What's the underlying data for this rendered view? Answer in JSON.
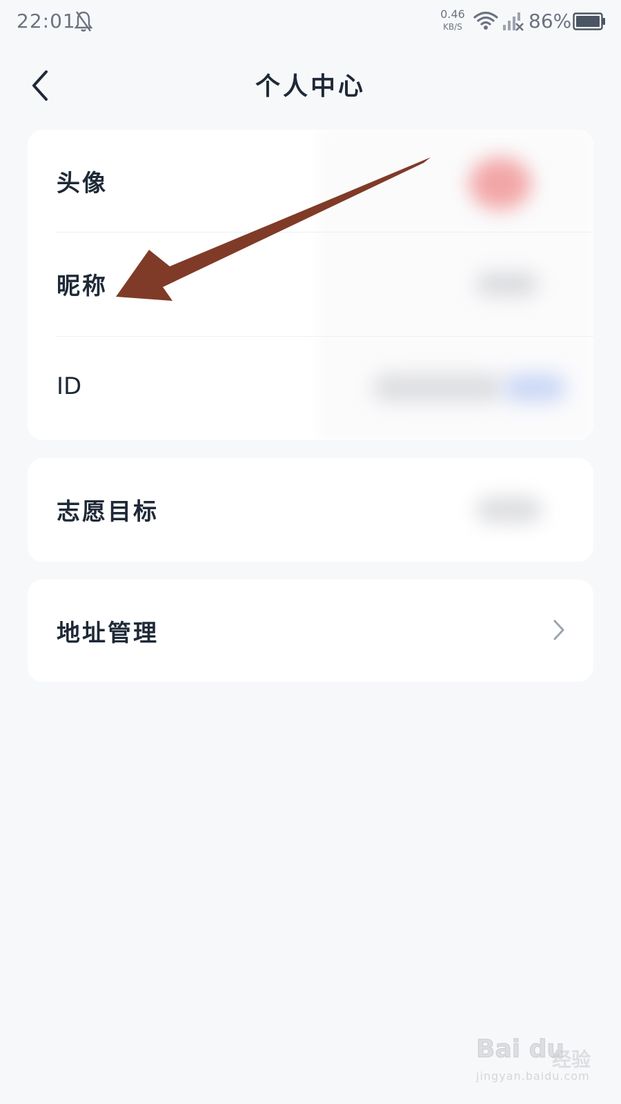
{
  "status_bar": {
    "time": "22:01",
    "net_speed_value": "0.46",
    "net_speed_unit": "KB/S",
    "battery_percent": "86%"
  },
  "header": {
    "title": "个人中心"
  },
  "profile_card": {
    "rows": [
      {
        "label": "头像"
      },
      {
        "label": "昵称"
      },
      {
        "label": "ID"
      }
    ]
  },
  "goal_card": {
    "label": "志愿目标"
  },
  "address_card": {
    "label": "地址管理"
  },
  "watermark": {
    "brand": "Bai du",
    "suffix": "经验",
    "url": "jingyan.baidu.com"
  },
  "colors": {
    "background": "#f7f8fa",
    "card": "#ffffff",
    "text": "#1f2937",
    "annotation_arrow": "#7f3b28",
    "avatar_blur": "#f2a6a6",
    "id_tag_blur": "#c9d6f5"
  },
  "icons": [
    "bell-off-icon",
    "wifi-icon",
    "signal-icon",
    "battery-icon",
    "back-icon",
    "chevron-right-icon"
  ]
}
